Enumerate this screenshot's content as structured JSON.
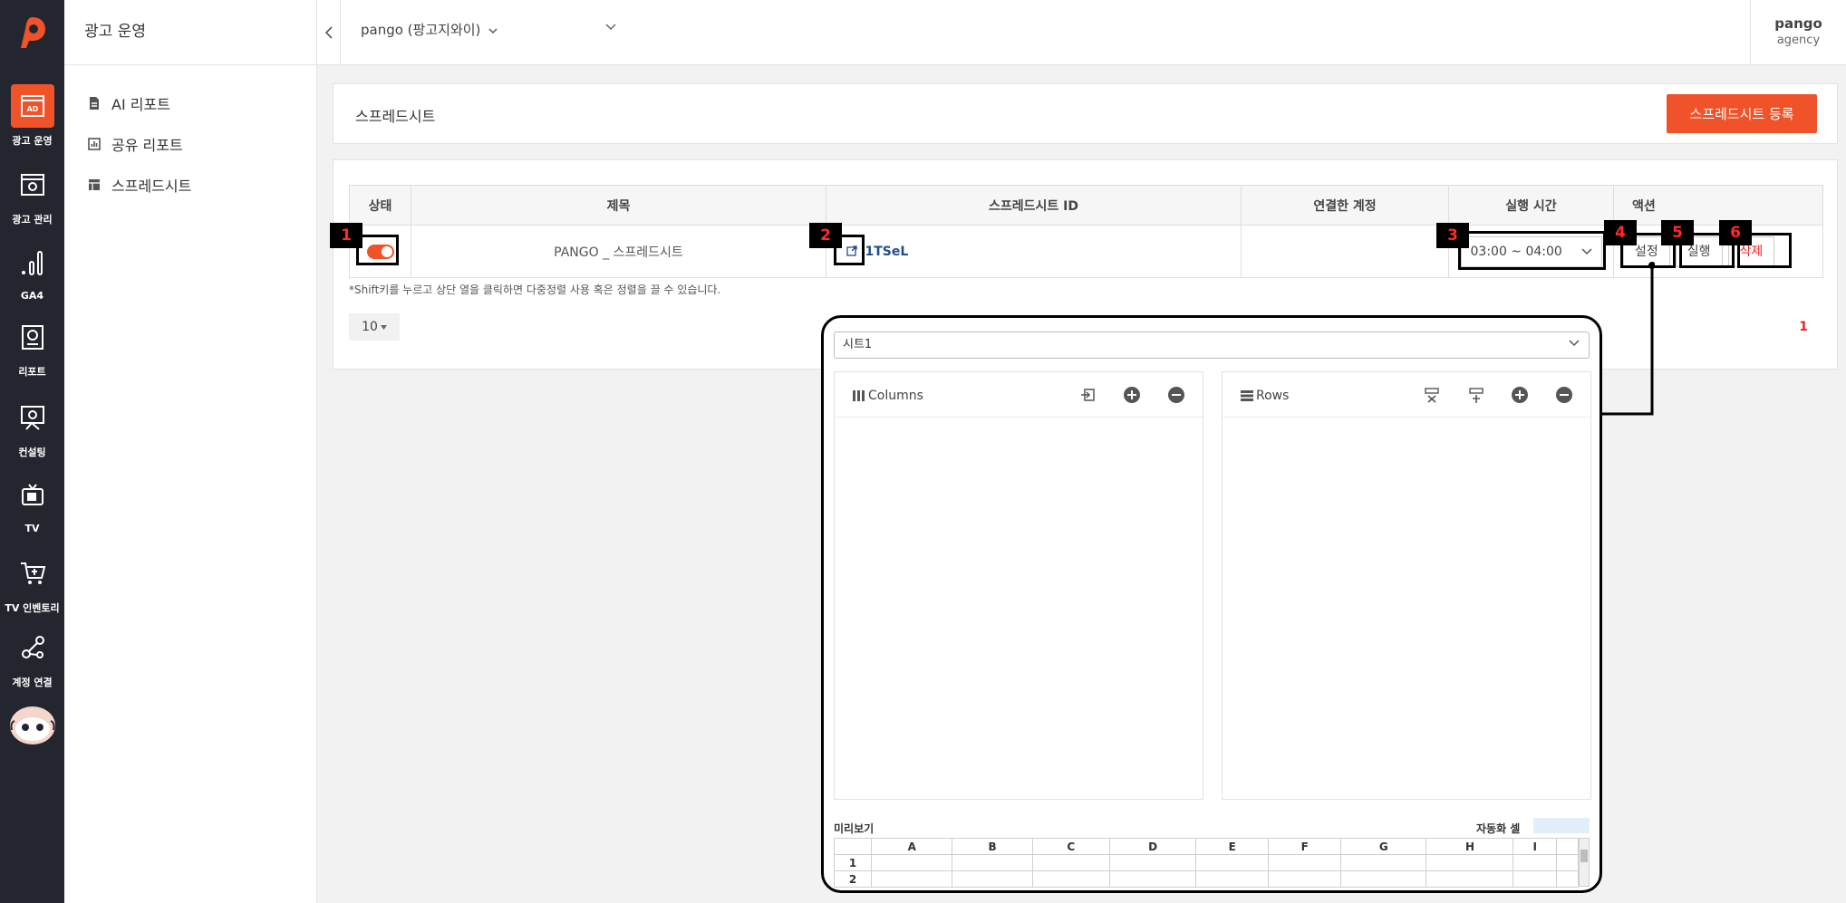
{
  "rail": {
    "items": [
      {
        "label": "광고 운영",
        "icon": "ad-icon",
        "active": true
      },
      {
        "label": "광고 관리",
        "icon": "ad-settings-icon"
      },
      {
        "label": "GA4",
        "icon": "bar-chart-icon"
      },
      {
        "label": "리포트",
        "icon": "report-icon"
      },
      {
        "label": "컨설팅",
        "icon": "consulting-icon"
      },
      {
        "label": "TV",
        "icon": "tv-icon"
      },
      {
        "label": "TV 인벤토리",
        "icon": "cart-icon"
      },
      {
        "label": "계정 연결",
        "icon": "link-nodes-icon"
      }
    ],
    "accent": "#f0532a"
  },
  "sidebar": {
    "title": "광고 운영",
    "items": [
      {
        "label": "AI 리포트",
        "icon": "document-icon"
      },
      {
        "label": "공유 리포트",
        "icon": "chart-box-icon"
      },
      {
        "label": "스프레드시트",
        "icon": "table-icon"
      }
    ]
  },
  "topbar": {
    "account": "pango (팡고지와이)",
    "user_name": "pango",
    "user_org": "agency"
  },
  "header": {
    "title": "스프레드시트",
    "register_button": "스프레드시트 등록"
  },
  "table": {
    "columns": [
      "상태",
      "제목",
      "스프레드시트 ID",
      "연결한 계정",
      "실행 시간",
      "액션"
    ],
    "rows": [
      {
        "status_on": true,
        "title": "PANGO _ 스프레드시트",
        "sheet_id": "1TSeL",
        "account": "",
        "run_time": "03:00 ~ 04:00",
        "actions": [
          "설정",
          "실행",
          "삭제"
        ]
      }
    ],
    "note": "*Shift키를 누르고 상단 열을 클릭하면 다중정렬 사용 혹은 정렬을 끌 수 있습니다.",
    "page_size": "10",
    "current_page": "1"
  },
  "markers": [
    "1",
    "2",
    "3",
    "4",
    "5",
    "6"
  ],
  "popup": {
    "sheet": "시트1",
    "columns_title": "Columns",
    "rows_title": "Rows",
    "preview_label": "미리보기",
    "auto_cell_label": "자동화 셀",
    "preview_columns": [
      "A",
      "B",
      "C",
      "D",
      "E",
      "F",
      "G",
      "H",
      "I"
    ],
    "preview_rows": [
      "1",
      "2"
    ]
  }
}
